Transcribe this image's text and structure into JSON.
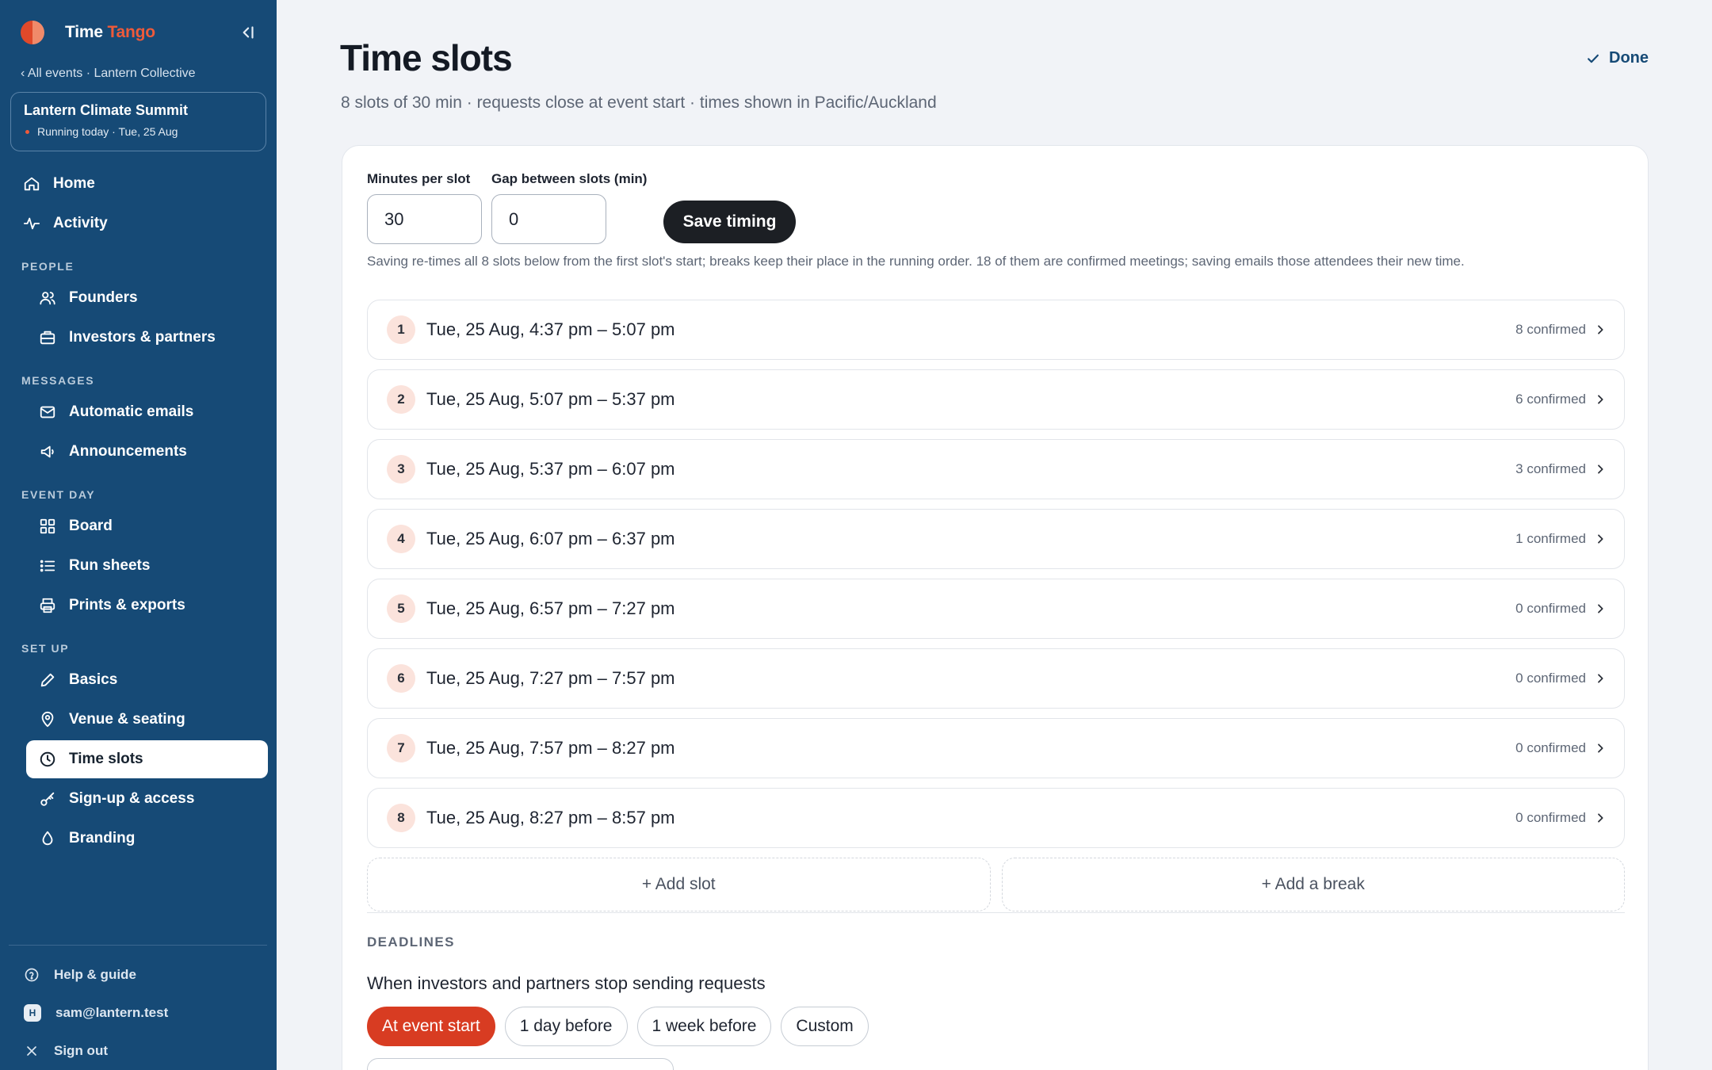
{
  "brand": {
    "name_primary": "Time",
    "name_accent": "Tango"
  },
  "sidebar": {
    "back_link": "‹ All events · Lantern Collective",
    "event": {
      "name": "Lantern Climate Summit",
      "status": "Running today · Tue, 25 Aug"
    },
    "top_items": [
      {
        "label": "Home",
        "icon": "home-icon"
      },
      {
        "label": "Activity",
        "icon": "activity-icon"
      }
    ],
    "sections": [
      {
        "title": "PEOPLE",
        "items": [
          {
            "label": "Founders",
            "icon": "users-icon"
          },
          {
            "label": "Investors & partners",
            "icon": "briefcase-icon"
          }
        ]
      },
      {
        "title": "MESSAGES",
        "items": [
          {
            "label": "Automatic emails",
            "icon": "mail-icon"
          },
          {
            "label": "Announcements",
            "icon": "megaphone-icon"
          }
        ]
      },
      {
        "title": "EVENT DAY",
        "items": [
          {
            "label": "Board",
            "icon": "grid-icon"
          },
          {
            "label": "Run sheets",
            "icon": "list-icon"
          },
          {
            "label": "Prints & exports",
            "icon": "printer-icon"
          }
        ]
      },
      {
        "title": "SET UP",
        "items": [
          {
            "label": "Basics",
            "icon": "pencil-icon"
          },
          {
            "label": "Venue & seating",
            "icon": "map-pin-icon"
          },
          {
            "label": "Time slots",
            "icon": "clock-icon",
            "active": true
          },
          {
            "label": "Sign-up & access",
            "icon": "key-icon"
          },
          {
            "label": "Branding",
            "icon": "droplet-icon"
          }
        ]
      }
    ],
    "footer": {
      "help": "Help & guide",
      "user": "sam@lantern.test",
      "avatar_letter": "H",
      "sign_out": "Sign out"
    }
  },
  "header": {
    "title": "Time slots",
    "subtitle": "8 slots of 30 min · requests close at event start · times shown in Pacific/Auckland",
    "done_label": "Done"
  },
  "timing": {
    "minutes_label": "Minutes per slot",
    "minutes_value": "30",
    "gap_label": "Gap between slots (min)",
    "gap_value": "0",
    "save_label": "Save timing",
    "help_text": "Saving re-times all 8 slots below from the first slot's start; breaks keep their place in the running order. 18 of them are confirmed meetings; saving emails those attendees their new time."
  },
  "slots": [
    {
      "num": "1",
      "time": "Tue, 25 Aug, 4:37 pm – 5:07 pm",
      "confirmed": "8 confirmed"
    },
    {
      "num": "2",
      "time": "Tue, 25 Aug, 5:07 pm – 5:37 pm",
      "confirmed": "6 confirmed"
    },
    {
      "num": "3",
      "time": "Tue, 25 Aug, 5:37 pm – 6:07 pm",
      "confirmed": "3 confirmed"
    },
    {
      "num": "4",
      "time": "Tue, 25 Aug, 6:07 pm – 6:37 pm",
      "confirmed": "1 confirmed"
    },
    {
      "num": "5",
      "time": "Tue, 25 Aug, 6:57 pm – 7:27 pm",
      "confirmed": "0 confirmed"
    },
    {
      "num": "6",
      "time": "Tue, 25 Aug, 7:27 pm – 7:57 pm",
      "confirmed": "0 confirmed"
    },
    {
      "num": "7",
      "time": "Tue, 25 Aug, 7:57 pm – 8:27 pm",
      "confirmed": "0 confirmed"
    },
    {
      "num": "8",
      "time": "Tue, 25 Aug, 8:27 pm – 8:57 pm",
      "confirmed": "0 confirmed"
    }
  ],
  "actions": {
    "add_slot": "+ Add slot",
    "add_break": "+ Add a break"
  },
  "deadlines": {
    "label": "DEADLINES",
    "question": "When investors and partners stop sending requests",
    "options": [
      {
        "label": "At event start",
        "active": true
      },
      {
        "label": "1 day before"
      },
      {
        "label": "1 week before"
      },
      {
        "label": "Custom"
      }
    ]
  },
  "colors": {
    "sidebar": "#164a76",
    "accent": "#d83c22",
    "brand_accent": "#ef5a3a",
    "dark_button": "#1c1f24"
  }
}
